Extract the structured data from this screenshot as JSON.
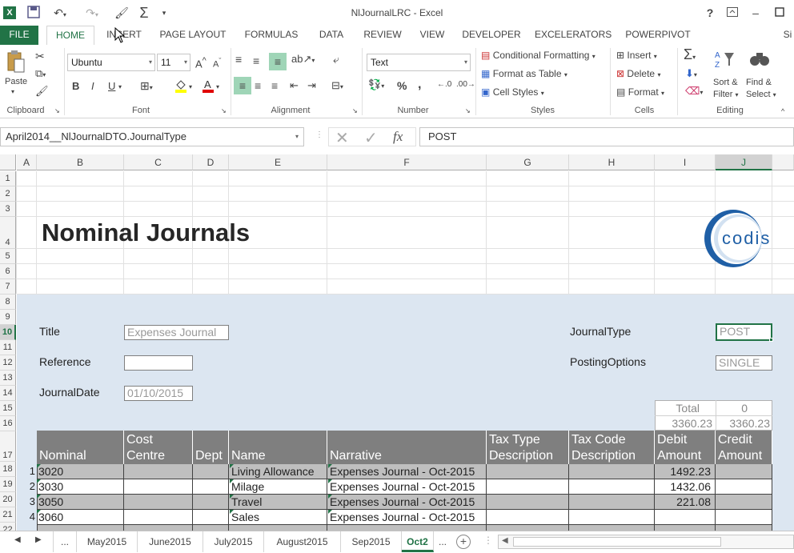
{
  "window": {
    "title": "NlJournalLRC - Excel",
    "help": "?",
    "user_short": "Si"
  },
  "ribbon_tabs": [
    "FILE",
    "HOME",
    "INSERT",
    "PAGE LAYOUT",
    "FORMULAS",
    "DATA",
    "REVIEW",
    "VIEW",
    "DEVELOPER",
    "EXCELERATORS",
    "POWERPIVOT"
  ],
  "ribbon": {
    "clipboard": {
      "paste": "Paste",
      "label": "Clipboard"
    },
    "font": {
      "name": "Ubuntu",
      "size": "11",
      "bold": "B",
      "italic": "I",
      "underline": "U",
      "label": "Font"
    },
    "alignment": {
      "label": "Alignment"
    },
    "number": {
      "format": "Text",
      "percent": "%",
      "comma": ",",
      "label": "Number"
    },
    "styles": {
      "conditional": "Conditional Formatting",
      "format_table": "Format as Table",
      "cell_styles": "Cell Styles",
      "label": "Styles"
    },
    "cells": {
      "insert": "Insert",
      "delete": "Delete",
      "format": "Format",
      "label": "Cells"
    },
    "editing": {
      "sort1": "Sort &",
      "sort2": "Filter",
      "find1": "Find &",
      "find2": "Select",
      "label": "Editing"
    }
  },
  "formula_bar": {
    "name_box": "April2014__NlJournalDTO.JournalType",
    "fx": "fx",
    "value": "POST"
  },
  "columns": [
    "A",
    "B",
    "C",
    "D",
    "E",
    "F",
    "G",
    "H",
    "I",
    "J"
  ],
  "rows": [
    "1",
    "2",
    "3",
    "4",
    "5",
    "6",
    "7",
    "8",
    "9",
    "10",
    "11",
    "12",
    "13",
    "14",
    "15",
    "16",
    "17",
    "18",
    "19",
    "20",
    "21",
    "22"
  ],
  "sheet": {
    "heading": "Nominal Journals",
    "logo_text": "codis",
    "title_label": "Title",
    "title_value": "Expenses Journal",
    "reference_label": "Reference",
    "reference_value": "",
    "journaldate_label": "JournalDate",
    "journaldate_value": "01/10/2015",
    "journaltype_label": "JournalType",
    "journaltype_value": "POST",
    "posting_label": "PostingOptions",
    "posting_value": "SINGLE",
    "total_label": "Total",
    "total_credit_count": "0",
    "total_debit": "3360.23",
    "total_credit": "3360.23",
    "headers": {
      "nominal": "Nominal",
      "cost1": "Cost",
      "cost2": "Centre",
      "dept": "Dept",
      "name": "Name",
      "narrative": "Narrative",
      "taxtype1": "Tax Type",
      "taxtype2": "Description",
      "taxcode1": "Tax Code",
      "taxcode2": "Description",
      "debit1": "Debit",
      "debit2": "Amount",
      "credit1": "Credit",
      "credit2": "Amount"
    },
    "lines": [
      {
        "n": "1",
        "nominal": "3020",
        "name": "Living Allowance",
        "narrative": "Expenses Journal - Oct-2015",
        "debit": "1492.23"
      },
      {
        "n": "2",
        "nominal": "3030",
        "name": "Milage",
        "narrative": "Expenses Journal - Oct-2015",
        "debit": "1432.06"
      },
      {
        "n": "3",
        "nominal": "3050",
        "name": "Travel",
        "narrative": "Expenses Journal - Oct-2015",
        "debit": "221.08"
      },
      {
        "n": "4",
        "nominal": "3060",
        "name": "Sales",
        "narrative": "Expenses Journal - Oct-2015",
        "debit": ""
      }
    ]
  },
  "sheet_tabs": [
    "...",
    "May2015",
    "June2015",
    "July2015",
    "August2015",
    "Sep2015",
    "Oct2",
    "..."
  ],
  "colors": {
    "excel_green": "#217346",
    "blue_area": "#dce6f1",
    "header_grey": "#7f7f7f",
    "row_grey": "#bfbfbf",
    "logo_blue": "#1f5fa6"
  }
}
